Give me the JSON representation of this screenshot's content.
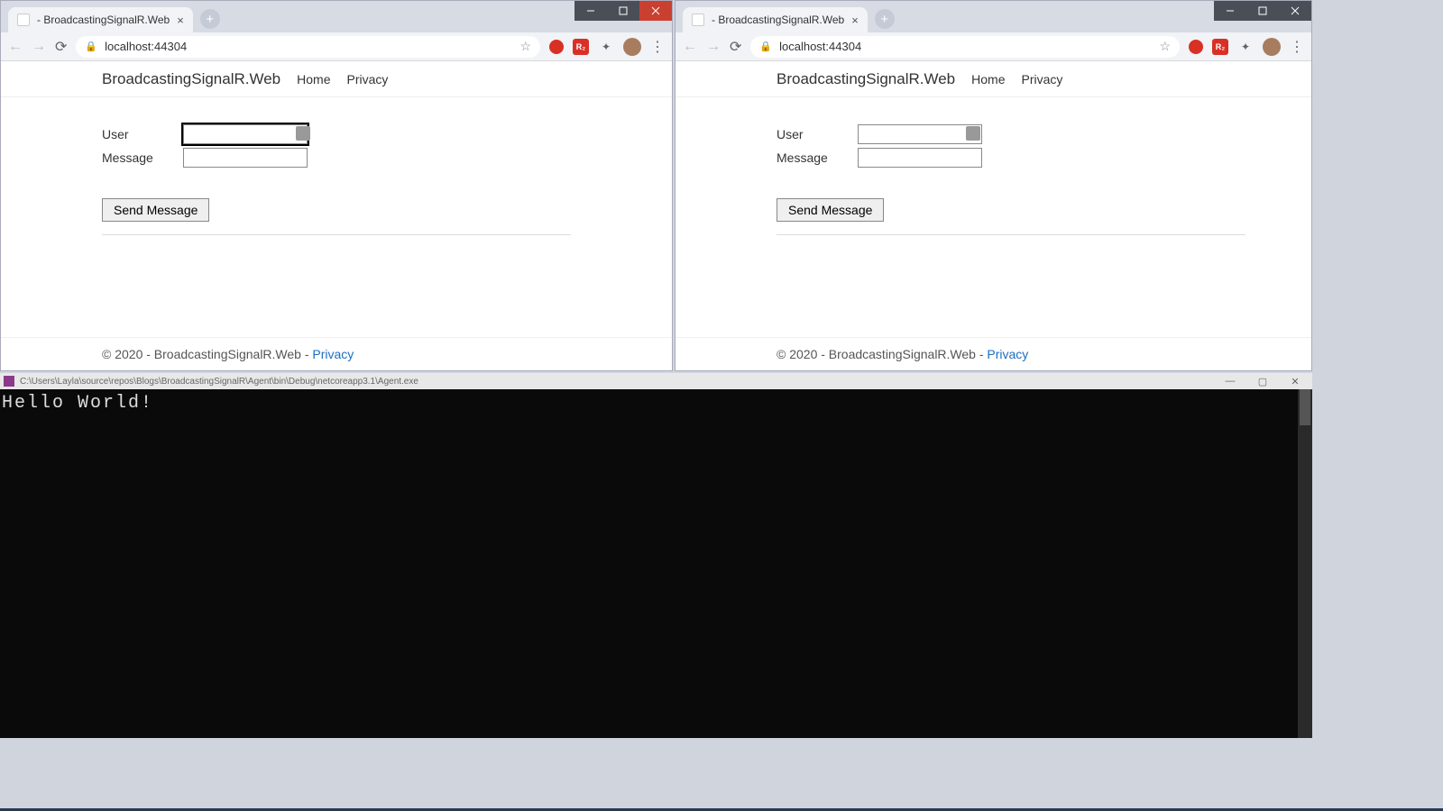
{
  "windows": [
    {
      "tab_title": " - BroadcastingSignalR.Web",
      "url": "localhost:44304",
      "page": {
        "brand": "BroadcastingSignalR.Web",
        "nav": {
          "home": "Home",
          "privacy": "Privacy"
        },
        "form": {
          "user_label": "User",
          "user_value": "",
          "message_label": "Message",
          "message_value": "",
          "send_label": "Send Message"
        },
        "footer_text": "© 2020 - BroadcastingSignalR.Web - ",
        "footer_link": "Privacy"
      }
    },
    {
      "tab_title": " - BroadcastingSignalR.Web",
      "url": "localhost:44304",
      "page": {
        "brand": "BroadcastingSignalR.Web",
        "nav": {
          "home": "Home",
          "privacy": "Privacy"
        },
        "form": {
          "user_label": "User",
          "user_value": "",
          "message_label": "Message",
          "message_value": "",
          "send_label": "Send Message"
        },
        "footer_text": "© 2020 - BroadcastingSignalR.Web - ",
        "footer_link": "Privacy"
      }
    }
  ],
  "console": {
    "title": "C:\\Users\\Layla\\source\\repos\\Blogs\\BroadcastingSignalR\\Agent\\bin\\Debug\\netcoreapp3.1\\Agent.exe",
    "output": "Hello World!"
  }
}
